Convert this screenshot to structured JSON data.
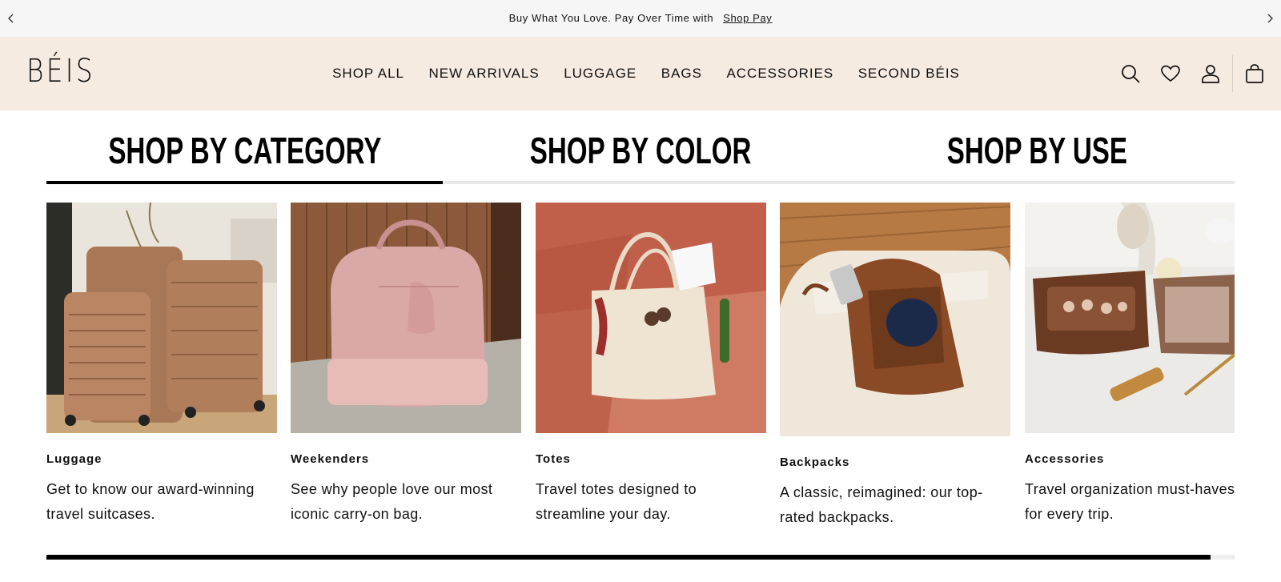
{
  "announcement": {
    "text": "Buy What You Love. Pay Over Time with",
    "link": "Shop Pay"
  },
  "header": {
    "logo": "BÉIS",
    "nav": [
      "SHOP ALL",
      "NEW ARRIVALS",
      "LUGGAGE",
      "BAGS",
      "ACCESSORIES",
      "SECOND BÉIS"
    ],
    "icons": [
      "search-icon",
      "heart-icon",
      "account-icon",
      "cart-icon"
    ]
  },
  "tabs": {
    "items": [
      "SHOP BY CATEGORY",
      "SHOP BY COLOR",
      "SHOP BY USE"
    ],
    "active": "SHOP BY CATEGORY"
  },
  "categories": [
    {
      "title": "Luggage",
      "description": "Get to know our award-winning travel suitcases."
    },
    {
      "title": "Weekenders",
      "description": "See why people love our most iconic carry-on bag."
    },
    {
      "title": "Totes",
      "description": "Travel totes designed to streamline your day."
    },
    {
      "title": "Backpacks",
      "description": "A classic, reimagined: our top-rated backpacks."
    },
    {
      "title": "Accessories",
      "description": "Travel organization must-haves for every trip."
    }
  ],
  "colors": {
    "announce_bg": "#f6f6f6",
    "header_bg": "#f6ebe0",
    "active_tab": "#000000",
    "inactive_line": "#e9e9e9"
  },
  "carousel": {
    "scroll_fraction": 0.98
  }
}
